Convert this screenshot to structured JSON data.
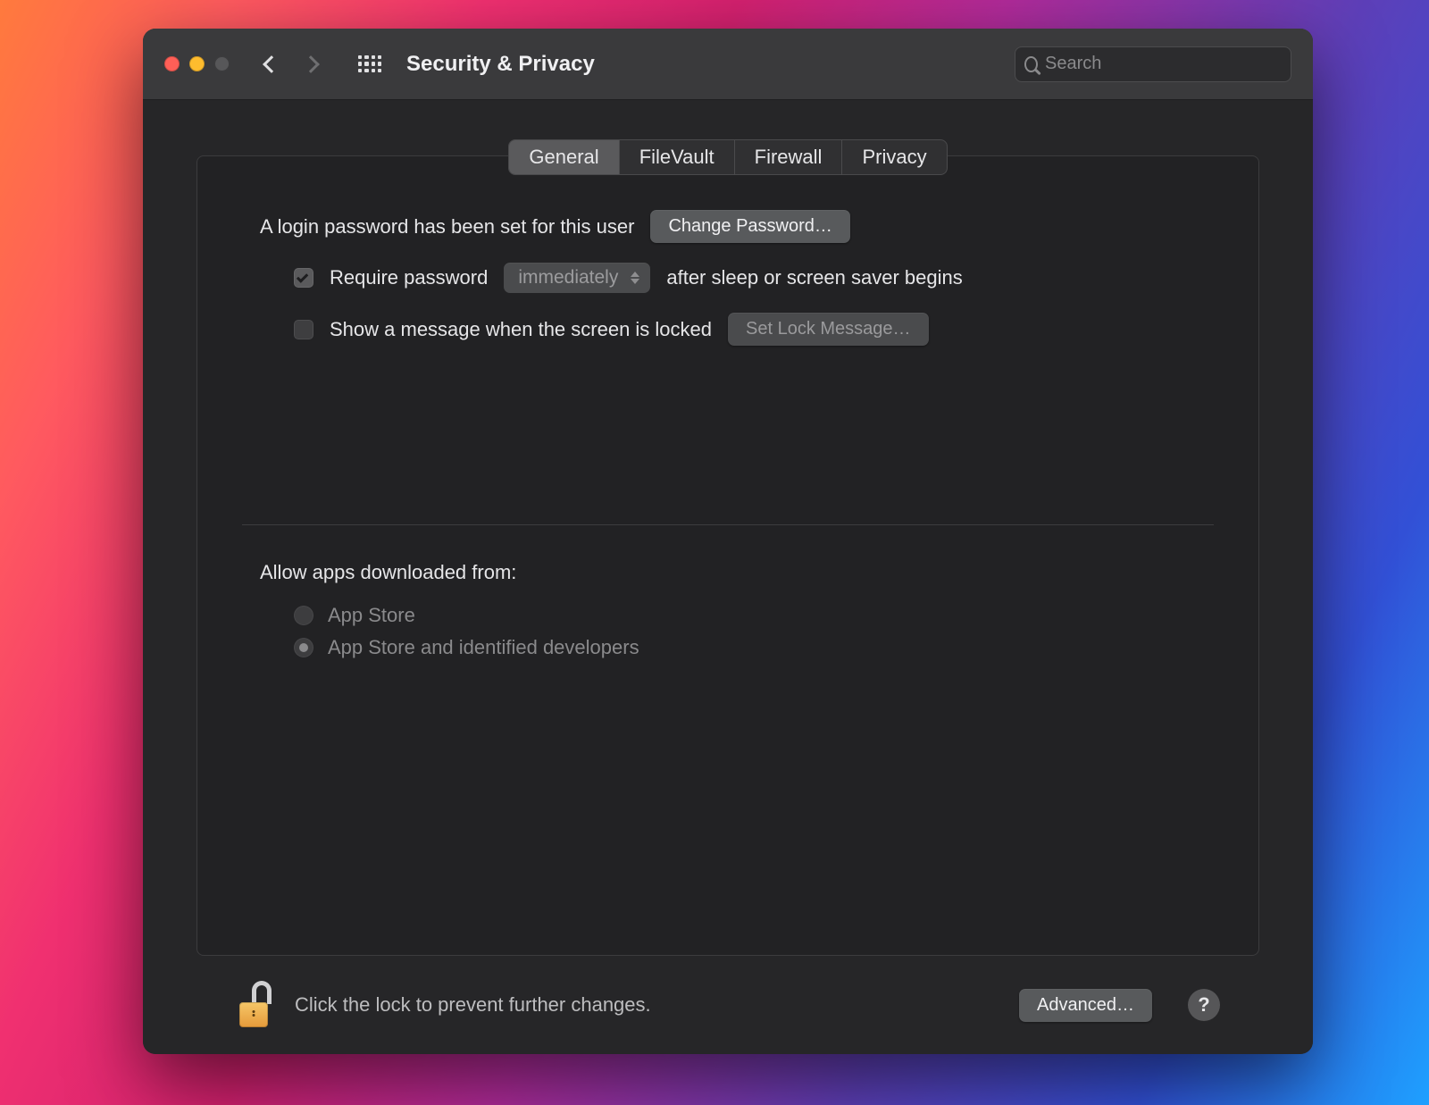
{
  "window": {
    "title": "Security & Privacy"
  },
  "search": {
    "placeholder": "Search",
    "value": ""
  },
  "tabs": [
    {
      "label": "General",
      "active": true
    },
    {
      "label": "FileVault",
      "active": false
    },
    {
      "label": "Firewall",
      "active": false
    },
    {
      "label": "Privacy",
      "active": false
    }
  ],
  "general": {
    "password_set_text": "A login password has been set for this user",
    "change_password_label": "Change Password…",
    "require_password_checked": true,
    "require_password_prefix": "Require password",
    "require_password_delay": "immediately",
    "require_password_suffix": "after sleep or screen saver begins",
    "show_message_checked": false,
    "show_message_label": "Show a message when the screen is locked",
    "set_lock_message_label": "Set Lock Message…",
    "allow_apps_title": "Allow apps downloaded from:",
    "allow_options": [
      {
        "label": "App Store",
        "selected": false
      },
      {
        "label": "App Store and identified developers",
        "selected": true
      }
    ]
  },
  "footer": {
    "lock_text": "Click the lock to prevent further changes.",
    "advanced_label": "Advanced…",
    "help_label": "?"
  }
}
